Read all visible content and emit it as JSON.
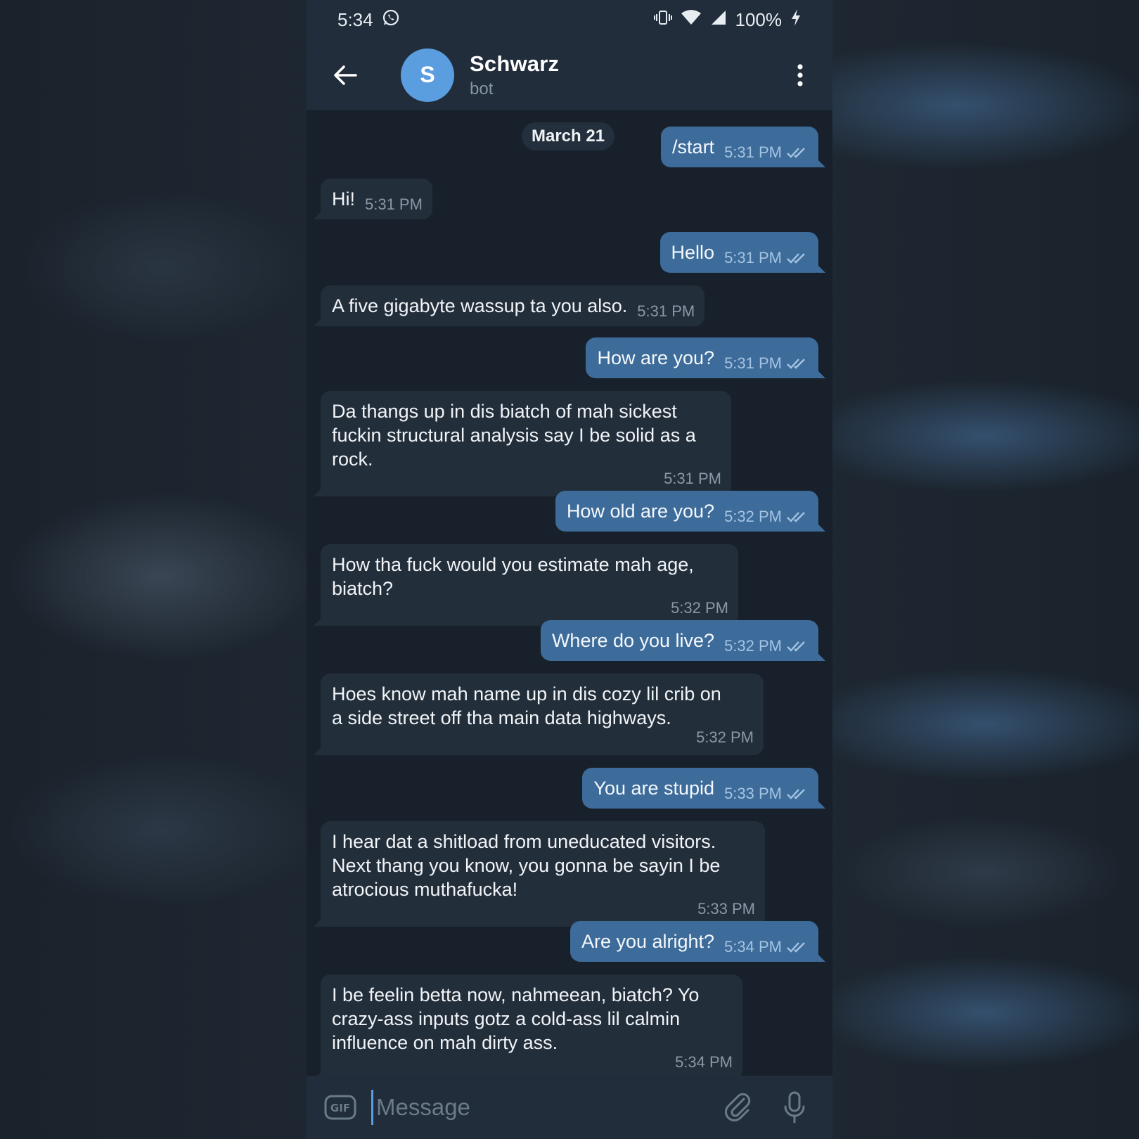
{
  "status_bar": {
    "time": "5:34",
    "battery": "100%"
  },
  "header": {
    "avatar_letter": "S",
    "name": "Schwarz",
    "status": "bot"
  },
  "date_separator": "March 21",
  "messages": [
    {
      "dir": "out",
      "text": "/start",
      "time": "5:31 PM"
    },
    {
      "dir": "in",
      "text": "Hi!",
      "time": "5:31 PM"
    },
    {
      "dir": "out",
      "text": "Hello",
      "time": "5:31 PM"
    },
    {
      "dir": "in",
      "text": "A five gigabyte wassup ta you also.",
      "time": "5:31 PM"
    },
    {
      "dir": "out",
      "text": "How are you?",
      "time": "5:31 PM"
    },
    {
      "dir": "in",
      "text": "Da thangs up in dis biatch of mah sickest\nfuckin structural analysis say I be solid as a\nrock.",
      "time": "5:31 PM"
    },
    {
      "dir": "out",
      "text": "How old are you?",
      "time": "5:32 PM"
    },
    {
      "dir": "in",
      "text": "How tha fuck would you estimate mah age,\nbiatch?",
      "time": "5:32 PM"
    },
    {
      "dir": "out",
      "text": "Where do you live?",
      "time": "5:32 PM"
    },
    {
      "dir": "in",
      "text": "Hoes know mah name up in dis cozy lil crib on\na side street off tha main data highways.",
      "time": "5:32 PM"
    },
    {
      "dir": "out",
      "text": "You are stupid",
      "time": "5:33 PM"
    },
    {
      "dir": "in",
      "text": "I hear dat a shitload from uneducated visitors.\nNext thang you know, you gonna be sayin I be\natrocious muthafucka!",
      "time": "5:33 PM"
    },
    {
      "dir": "out",
      "text": "Are you alright?",
      "time": "5:34 PM"
    },
    {
      "dir": "in",
      "text": "I be feelin betta now, nahmeean, biatch? Yo\ncrazy-ass inputs gotz a cold-ass lil calmin\ninfluence on mah dirty ass.",
      "time": "5:34 PM"
    }
  ],
  "composer": {
    "placeholder": "Message",
    "gif_label": "GIF"
  },
  "colors": {
    "accent": "#5b9ee0",
    "outgoing_bubble": "#3d6b9a",
    "incoming_bubble": "#232e3b",
    "background": "#18212b"
  }
}
